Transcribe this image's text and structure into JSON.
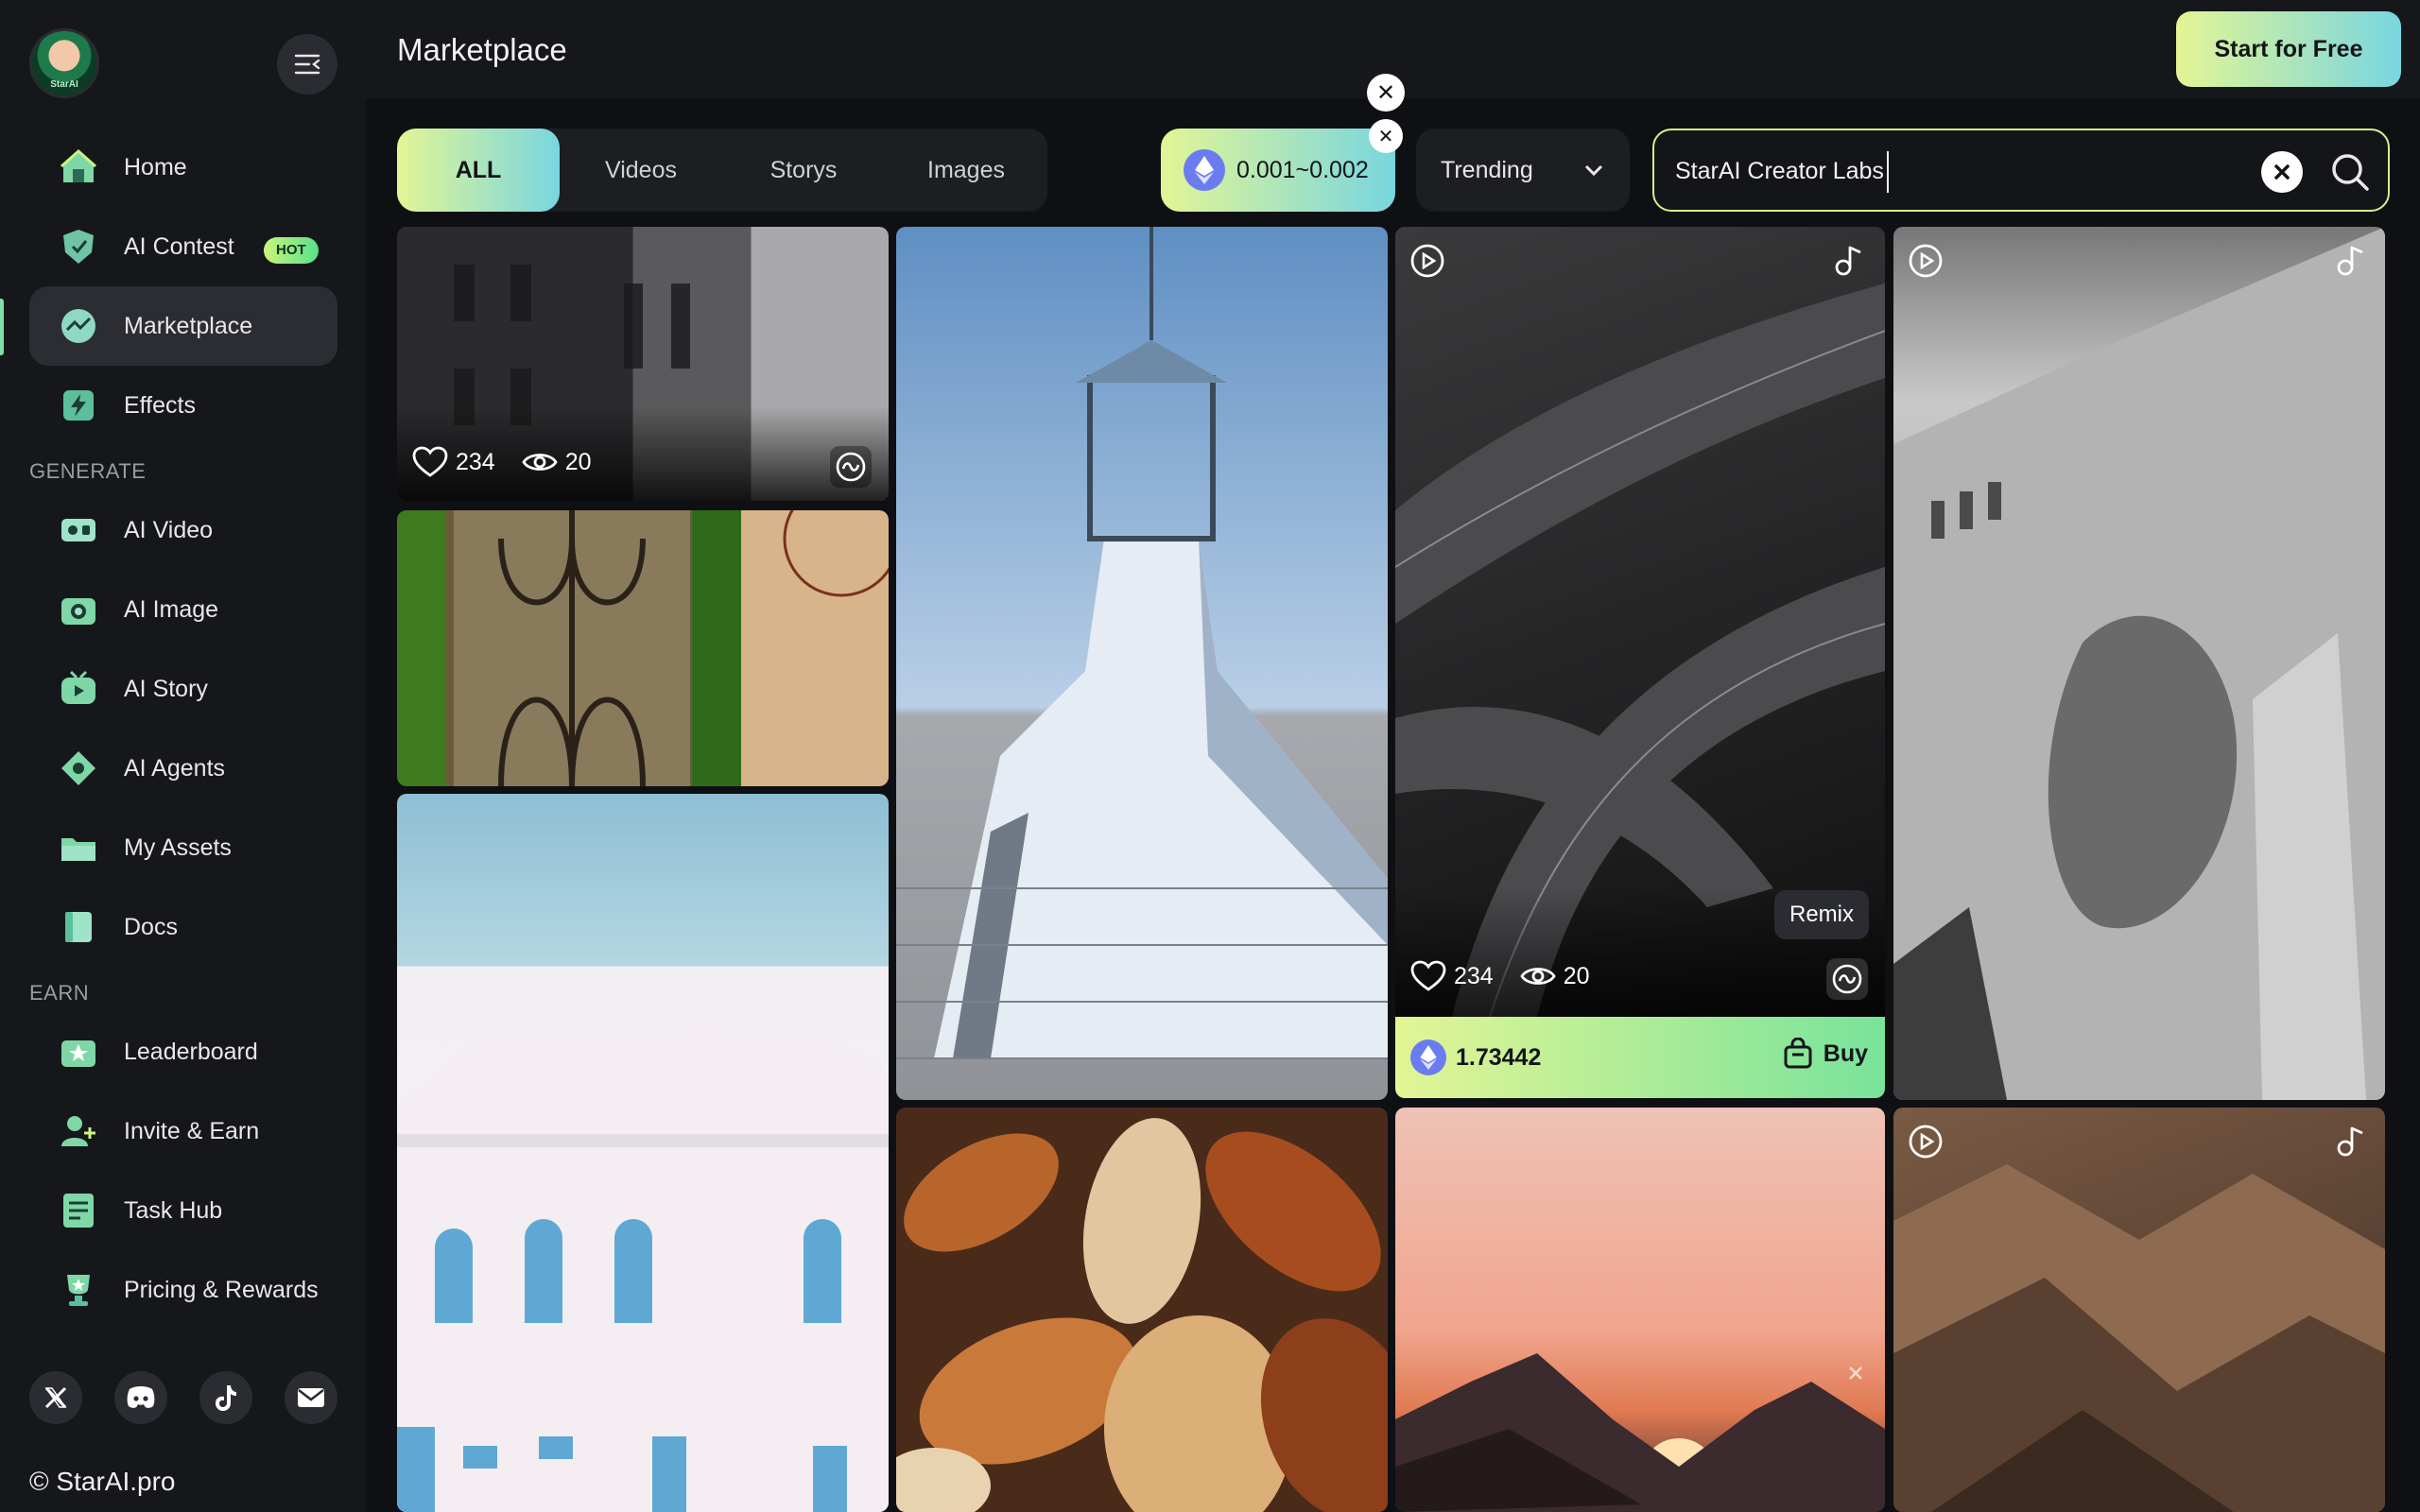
{
  "brand": {
    "avatar_tag": "StarAI",
    "copyright": "© StarAI.pro"
  },
  "sidebar": {
    "nav": [
      {
        "label": "Home"
      },
      {
        "label": "AI Contest",
        "badge": "HOT"
      },
      {
        "label": "Marketplace",
        "active": true
      },
      {
        "label": "Effects"
      }
    ],
    "sections": {
      "generate": "GENERATE",
      "earn": "EARN"
    },
    "generate": [
      {
        "label": "AI Video"
      },
      {
        "label": "AI Image"
      },
      {
        "label": "AI Story"
      },
      {
        "label": "AI Agents"
      },
      {
        "label": "My Assets"
      },
      {
        "label": "Docs"
      }
    ],
    "earn": [
      {
        "label": "Leaderboard"
      },
      {
        "label": "Invite & Earn"
      },
      {
        "label": "Task Hub"
      },
      {
        "label": "Pricing & Rewards"
      }
    ],
    "social": [
      "x-icon",
      "discord-icon",
      "tiktok-icon",
      "mail-icon"
    ]
  },
  "header": {
    "title": "Marketplace",
    "cta": "Start for Free"
  },
  "filters": {
    "tabs": [
      {
        "label": "ALL",
        "active": true
      },
      {
        "label": "Videos"
      },
      {
        "label": "Storys"
      },
      {
        "label": "Images"
      }
    ],
    "price_range": "0.001~0.002",
    "sort": "Trending",
    "search_value": "StarAI Creator Labs"
  },
  "cards": {
    "card1": {
      "likes": "234",
      "views": "20"
    },
    "card5": {
      "likes": "234",
      "views": "20",
      "tooltip": "Remix",
      "price": "1.73442",
      "buy": "Buy"
    }
  },
  "colors": {
    "accent_start": "#e3f595",
    "accent_end": "#78d6e0",
    "eth": "#6b7cf0",
    "sidebar": "#16171b"
  }
}
